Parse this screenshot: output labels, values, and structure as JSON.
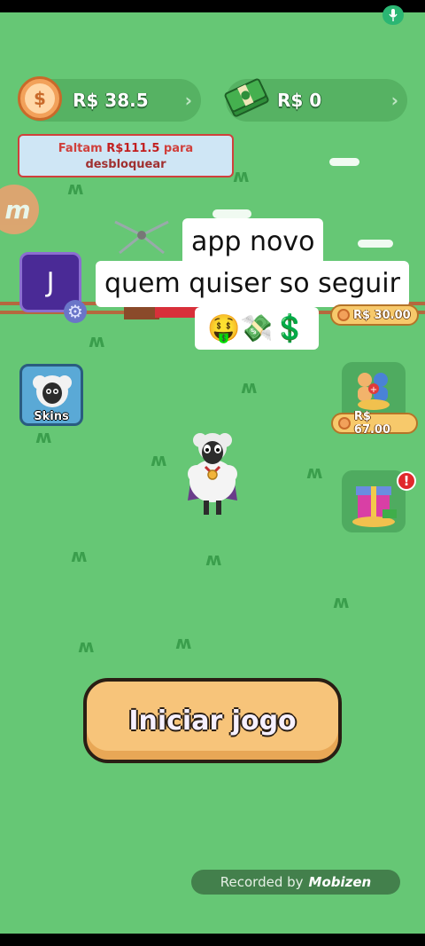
{
  "header": {
    "coins_amount": "R$ 38.5",
    "cash_amount": "R$ 0",
    "unlock_tooltip": {
      "line1_prefix": "Faltam ",
      "line1_amount": "R$111.5",
      "line1_suffix": " para",
      "line2": "desbloquear"
    }
  },
  "overlay": {
    "line1": "app novo",
    "line2": "quem quiser so seguir",
    "emojis": "🤑💸💲"
  },
  "avatar_letter": "J",
  "skins_label": "Skins",
  "rewards": [
    {
      "price": "R$ 30.00"
    },
    {
      "price": "R$ 67.00"
    }
  ],
  "gift_badge": "!",
  "start_button": "Iniciar jogo",
  "recorder": {
    "prefix": "Recorded by",
    "brand": "Mobizen"
  },
  "brand_logo_letter": "m",
  "icons": [
    "mic-icon",
    "coin-icon",
    "cash-icon",
    "chevron-right-icon",
    "gear-icon",
    "sheep-icon",
    "gift-icon"
  ]
}
